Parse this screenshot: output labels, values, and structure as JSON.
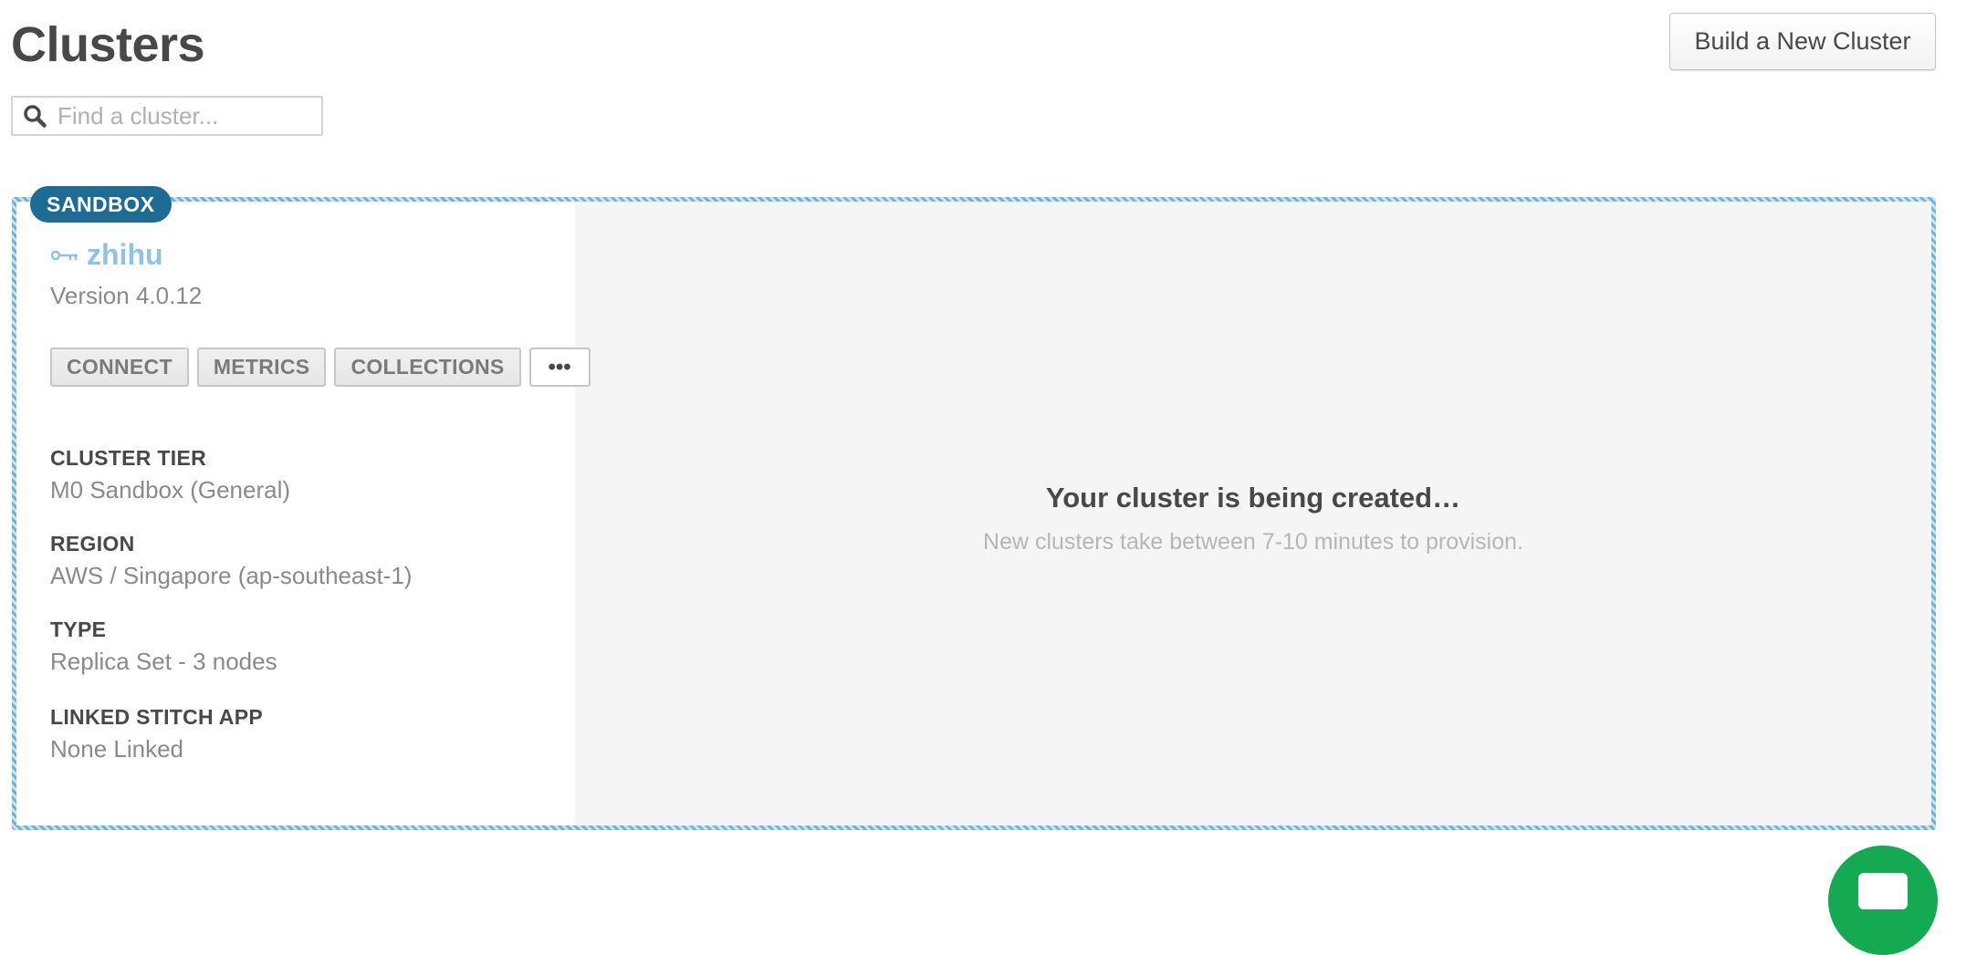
{
  "header": {
    "title": "Clusters",
    "build_button_label": "Build a New Cluster"
  },
  "search": {
    "placeholder": "Find a cluster...",
    "icon": "search-icon"
  },
  "cluster": {
    "badge": "SANDBOX",
    "name": "zhihu",
    "name_icon": "key-icon",
    "version": "Version 4.0.12",
    "buttons": {
      "connect": "CONNECT",
      "metrics": "METRICS",
      "collections": "COLLECTIONS",
      "more": "•••"
    },
    "info": {
      "tier_label": "CLUSTER TIER",
      "tier_value": "M0 Sandbox (General)",
      "region_label": "REGION",
      "region_value": "AWS / Singapore (ap-southeast-1)",
      "type_label": "TYPE",
      "type_value": "Replica Set - 3 nodes",
      "stitch_label": "LINKED STITCH APP",
      "stitch_value": "None Linked"
    },
    "status": {
      "title": "Your cluster is being created…",
      "subtitle": "New clusters take between 7-10 minutes to provision."
    }
  },
  "colors": {
    "badge": "#1e6c94",
    "cluster_name": "#8fc3e6",
    "chat_button": "#13aa52",
    "card_border": "#6fb4d8"
  }
}
